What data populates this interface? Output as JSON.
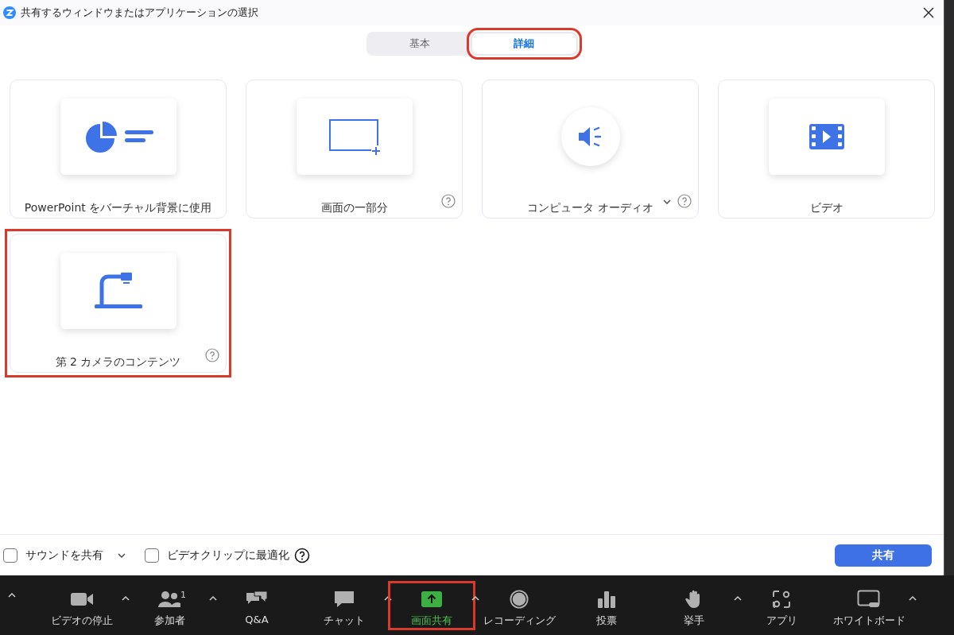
{
  "window": {
    "title": "共有するウィンドウまたはアプリケーションの選択"
  },
  "tabs": [
    {
      "label": "基本",
      "selected": false,
      "highlighted": false
    },
    {
      "label": "詳細",
      "selected": true,
      "highlighted": true
    }
  ],
  "cards": [
    {
      "kind": "powerpoint",
      "label": "PowerPoint をバーチャル背景に使用",
      "help": false,
      "dropdown": false,
      "highlighted": false
    },
    {
      "kind": "screen-portion",
      "label": "画面の一部分",
      "help": true,
      "dropdown": false,
      "highlighted": false
    },
    {
      "kind": "audio",
      "label": "コンピュータ オーディオ",
      "help": true,
      "dropdown": true,
      "highlighted": false
    },
    {
      "kind": "video",
      "label": "ビデオ",
      "help": false,
      "dropdown": false,
      "highlighted": false
    },
    {
      "kind": "camera",
      "label": "第 2 カメラのコンテンツ",
      "help": true,
      "dropdown": false,
      "highlighted": true
    }
  ],
  "options": [
    {
      "label": "サウンドを共有",
      "checked": false,
      "dropdown": true,
      "help": false
    },
    {
      "label": "ビデオクリップに最適化",
      "checked": false,
      "dropdown": false,
      "help": true
    }
  ],
  "share_button": "共有",
  "toolbar": {
    "leading_caret": true,
    "items": [
      {
        "kind": "video",
        "label": "ビデオの停止",
        "caret": true,
        "selected": false,
        "highlighted": false
      },
      {
        "kind": "participants",
        "label": "参加者",
        "badge": "1",
        "caret": true,
        "selected": false,
        "highlighted": false
      },
      {
        "kind": "qa",
        "label": "Q&A",
        "caret": false,
        "selected": false,
        "highlighted": false
      },
      {
        "kind": "chat",
        "label": "チャット",
        "caret": true,
        "selected": false,
        "highlighted": false
      },
      {
        "kind": "share",
        "label": "画面共有",
        "caret": true,
        "selected": true,
        "highlighted": true
      },
      {
        "kind": "record",
        "label": "レコーディング",
        "caret": false,
        "selected": false,
        "highlighted": false
      },
      {
        "kind": "poll",
        "label": "投票",
        "caret": false,
        "selected": false,
        "highlighted": false
      },
      {
        "kind": "hand",
        "label": "挙手",
        "caret": true,
        "selected": false,
        "highlighted": false
      },
      {
        "kind": "apps",
        "label": "アプリ",
        "caret": false,
        "selected": false,
        "highlighted": false
      },
      {
        "kind": "whiteboard",
        "label": "ホワイトボード",
        "caret": true,
        "selected": false,
        "highlighted": false
      }
    ]
  }
}
